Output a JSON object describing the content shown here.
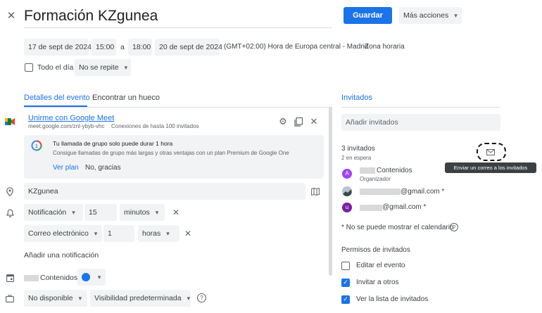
{
  "header": {
    "close_icon": "close-icon",
    "title": "Formación KZgunea",
    "save_label": "Guardar",
    "more_actions_label": "Más acciones"
  },
  "datetime": {
    "start_date": "17 de sept de 2024",
    "start_time": "15:00",
    "separator": "a",
    "end_time": "18:00",
    "end_date": "20 de sept de 2024",
    "timezone": "(GMT+02:00) Hora de Europa central - Madrid",
    "timezone_link": "Zona horaria",
    "all_day_label": "Todo el día",
    "all_day_checked": false,
    "repeat": "No se repite"
  },
  "tabs": {
    "event_details": "Detalles del evento",
    "find_slot": "Encontrar un hueco",
    "guests": "Invitados"
  },
  "meet": {
    "link_text": "Unirme con Google Meet",
    "url": "meet.google.com/znl-ybyb-vhc",
    "connections": "Conexiones de hasta 100 invitados",
    "notice_title": "Tu llamada de grupo solo puede durar 1 hora",
    "notice_body": "Consigue llamadas de grupo más largas y otras ventajas con un plan Premium de Google One",
    "view_plan": "Ver plan",
    "no_thanks": "No, gracias"
  },
  "location": {
    "value": "KZgunea"
  },
  "notifications": [
    {
      "type": "Notificación",
      "amount": "15",
      "unit": "minutos"
    },
    {
      "type": "Correo electrónico",
      "amount": "1",
      "unit": "horas"
    }
  ],
  "add_notification": "Añadir una notificación",
  "calendar": {
    "name": "Contenidos",
    "color": "#1a73e8"
  },
  "availability": {
    "status": "No disponible",
    "visibility": "Visibilidad predeterminada"
  },
  "guests": {
    "add_placeholder": "Añadir invitados",
    "count_label": "3 invitados",
    "waiting_label": "2 en espera",
    "list": [
      {
        "initial": "A",
        "name": "Contenidos",
        "role": "Organizador",
        "color": "#a142f4"
      },
      {
        "initial": "",
        "name": "@gmail.com *",
        "role": "",
        "color": "#5f6368"
      },
      {
        "initial": "u",
        "name": "@gmail.com *",
        "role": "",
        "color": "#7b1fa2"
      }
    ],
    "calendar_note": "* No se puede mostrar el calendario",
    "email_tooltip": "Enviar un correo a los invitados"
  },
  "permissions": {
    "title": "Permisos de invitados",
    "items": [
      {
        "label": "Editar el evento",
        "checked": false
      },
      {
        "label": "Invitar a otros",
        "checked": true
      },
      {
        "label": "Ver la lista de invitados",
        "checked": true
      }
    ]
  }
}
